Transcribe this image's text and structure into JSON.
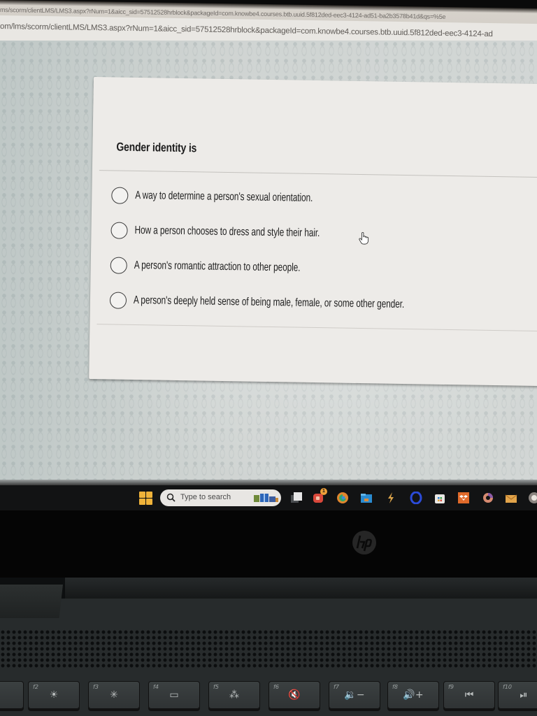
{
  "browser": {
    "url_partial_back": "ms/scorm/clientLMS/LMS3.aspx?rNum=1&aicc_sid=57512528hrblock&packageId=com.knowbe4.courses.btb.uuid.5f812ded-eec3-4124-ad51-ba2b3578b41d&qs=%5e",
    "url_partial_front": "om/lms/scorm/clientLMS/LMS3.aspx?rNum=1&aicc_sid=57512528hrblock&packageId=com.knowbe4.courses.btb.uuid.5f812ded-eec3-4124-ad"
  },
  "quiz": {
    "question": "Gender identity is",
    "options": [
      {
        "label": "A way to determine a person's sexual orientation.",
        "selected": false
      },
      {
        "label": "How a person chooses to dress and style their hair.",
        "selected": false
      },
      {
        "label": "A person's romantic attraction to other people.",
        "selected": false
      },
      {
        "label": "A person's deeply held sense of being male, female, or some other gender.",
        "selected": false
      }
    ]
  },
  "taskbar": {
    "search_placeholder": "Type to search",
    "apps": [
      {
        "name": "task-view",
        "icon": "task-view-icon"
      },
      {
        "name": "meet-chat",
        "icon": "video-chat-icon",
        "badge": "1"
      },
      {
        "name": "edge",
        "icon": "edge-icon"
      },
      {
        "name": "file-explorer",
        "icon": "folder-icon"
      },
      {
        "name": "app-lightning",
        "icon": "lightning-icon"
      },
      {
        "name": "opera",
        "icon": "opera-icon"
      },
      {
        "name": "microsoft-store",
        "icon": "store-icon"
      },
      {
        "name": "dropbox",
        "icon": "dropbox-icon"
      },
      {
        "name": "copilot",
        "icon": "copilot-icon"
      },
      {
        "name": "mail",
        "icon": "mail-icon"
      }
    ]
  },
  "laptop": {
    "brand": "hp",
    "function_keys": [
      {
        "fn": "f2",
        "glyph": "☀"
      },
      {
        "fn": "f3",
        "glyph": "✳"
      },
      {
        "fn": "f4",
        "glyph": "▭"
      },
      {
        "fn": "f5",
        "glyph": "⁂"
      },
      {
        "fn": "f6",
        "glyph": "🔇"
      },
      {
        "fn": "f7",
        "glyph": "🔉−"
      },
      {
        "fn": "f8",
        "glyph": "🔊+"
      },
      {
        "fn": "f9",
        "glyph": "⏮"
      },
      {
        "fn": "f10",
        "glyph": "⏯"
      }
    ]
  },
  "colors": {
    "accent_windows": "#f0b33a",
    "card_bg": "#edebe8",
    "text": "#1f1f1f"
  }
}
